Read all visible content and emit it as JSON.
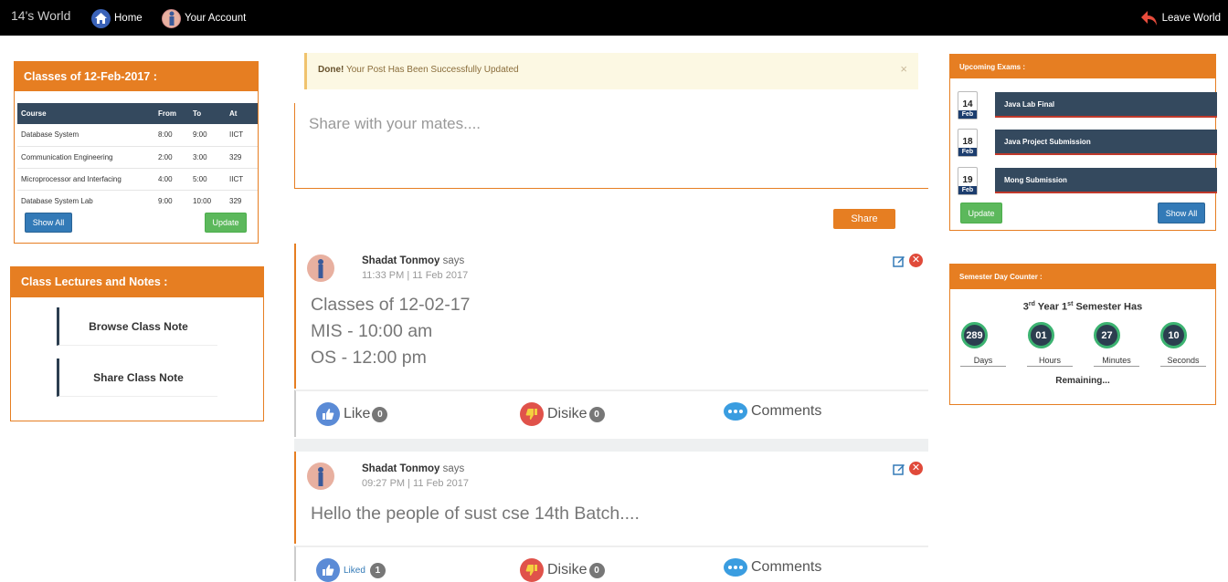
{
  "nav": {
    "brand": "14's World",
    "home": "Home",
    "account": "Your Account",
    "leave": "Leave World"
  },
  "classes": {
    "title": "Classes of 12-Feb-2017 :",
    "headers": [
      "Course",
      "From",
      "To",
      "At"
    ],
    "rows": [
      [
        "Database System",
        "8:00",
        "9:00",
        "IICT"
      ],
      [
        "Communication Engineering",
        "2:00",
        "3:00",
        "329"
      ],
      [
        "Microprocessor and Interfacing",
        "4:00",
        "5:00",
        "IICT"
      ],
      [
        "Database System Lab",
        "9:00",
        "10:00",
        "329"
      ]
    ],
    "show_all": "Show All",
    "update": "Update"
  },
  "lectures": {
    "title": "Class Lectures and Notes :",
    "browse": "Browse Class Note",
    "share": "Share Class Note"
  },
  "alert": {
    "strong": "Done!",
    "message": " Your Post Has Been Successfully Updated",
    "close": "×"
  },
  "composer": {
    "placeholder": "Share with your mates....",
    "share": "Share"
  },
  "posts": [
    {
      "author": "Shadat Tonmoy",
      "says": " says",
      "time": "11:33 PM | 11 Feb 2017",
      "lines": [
        "Classes of 12-02-17",
        "MIS - 10:00 am",
        "OS - 12:00 pm"
      ],
      "like": "Like",
      "like_count": "0",
      "dislike": "Disike",
      "dislike_count": "0",
      "comments": "Comments"
    },
    {
      "author": "Shadat Tonmoy",
      "says": " says",
      "time": "09:27 PM | 11 Feb 2017",
      "lines": [
        "Hello the people of sust cse 14th Batch...."
      ],
      "like": "Liked",
      "like_count": "1",
      "dislike": "Disike",
      "dislike_count": "0",
      "comments": "Comments"
    }
  ],
  "exams": {
    "title": "Upcoming Exams :",
    "items": [
      {
        "day": "14",
        "month": "Feb",
        "name": "Java Lab Final"
      },
      {
        "day": "18",
        "month": "Feb",
        "name": "Java Project Submission"
      },
      {
        "day": "19",
        "month": "Feb",
        "name": "Mong Submission"
      }
    ],
    "update": "Update",
    "show_all": "Show All"
  },
  "counter": {
    "title": "Semester Day Counter :",
    "year": "3",
    "year_sup": "rd",
    "year_word": " Year ",
    "sem": "1",
    "sem_sup": "st",
    "sem_word": " Semester Has",
    "values": [
      {
        "value": "289",
        "label": "Days"
      },
      {
        "value": "01",
        "label": "Hours"
      },
      {
        "value": "27",
        "label": "Minutes"
      },
      {
        "value": "10",
        "label": "Seconds"
      }
    ],
    "remaining": "Remaining..."
  },
  "colors": {
    "accent": "#e67e22",
    "dark": "#34495e",
    "primary": "#337ab7",
    "success": "#5cb85c"
  },
  "icons": [
    "home-icon",
    "avatar-icon",
    "leave-icon",
    "edit-icon",
    "delete-icon",
    "like-icon",
    "dislike-icon",
    "comments-icon",
    "calendar-icon"
  ]
}
